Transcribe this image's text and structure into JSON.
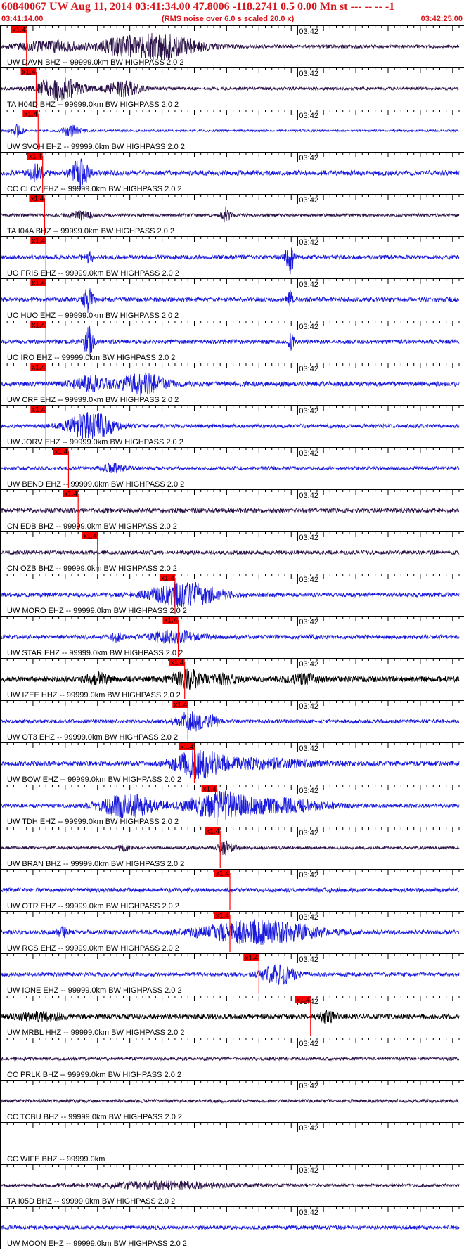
{
  "header": {
    "title": "60840067 UW Aug 11, 2014 03:41:34.00   47.8006 -118.2741  0.5 0.00 Mn st --- -- --  -1",
    "start_time": "03:41:14.00",
    "rms_note": "(RMS noise over 6.0 s scaled 20.0 x)",
    "end_time": "03:42:25.00"
  },
  "colors": {
    "header_text": "#d8141c",
    "pick_line": "#ff0000",
    "pick_flag": "#ff0000",
    "trace_blue": "#1a1adc",
    "trace_dark": "#2b1248",
    "trace_black": "#000000",
    "axis": "#000000"
  },
  "chart_data": {
    "type": "seismogram",
    "time_range": [
      "03:41:14.00",
      "03:42:25.00"
    ],
    "minute_tick_label": "03:42",
    "pick_flag_label": "x1.4",
    "traces": [
      {
        "label": "UW DAVN BHZ -- 99999.0km BW  HIGHPASS  2.0  2",
        "color": "dark",
        "pick_time": "03:41:18.0",
        "bursts": [
          {
            "t": 24.5,
            "w": 7,
            "a": 3.0
          },
          {
            "t": 8,
            "w": 6,
            "a": 1.2
          },
          {
            "t": 18,
            "w": 3,
            "a": 1.0
          }
        ],
        "base": 0.4
      },
      {
        "label": "TA H04D BHZ -- 99999.0km BW  HIGHPASS  2.0  2",
        "color": "dark",
        "pick_time": "03:41:19.5",
        "bursts": [
          {
            "t": 9,
            "w": 4,
            "a": 2.6
          },
          {
            "t": 19,
            "w": 3,
            "a": 1.7
          }
        ],
        "base": 0.35
      },
      {
        "label": "UW SVOH EHZ -- 99999.0km BW  HIGHPASS  2.0  2",
        "color": "blue",
        "pick_time": "03:41:19.8",
        "bursts": [
          {
            "t": 2.5,
            "w": 1,
            "a": 1.6
          },
          {
            "t": 11,
            "w": 1.5,
            "a": 1.5
          }
        ],
        "base": 0.25
      },
      {
        "label": "CC CLCV EHZ -- 99999.0km BW  HIGHPASS  2.0  2",
        "color": "blue",
        "pick_time": "03:41:20.5",
        "bursts": [
          {
            "t": 5.5,
            "w": 1.2,
            "a": 2.0
          },
          {
            "t": 12.3,
            "w": 1.5,
            "a": 3.4
          }
        ],
        "base": 0.6
      },
      {
        "label": "TA I04A BHZ -- 99999.0km BW  HIGHPASS  2.0  2",
        "color": "dark",
        "pick_time": "03:41:20.8",
        "bursts": [
          {
            "t": 34.9,
            "w": 0.8,
            "a": 1.6
          },
          {
            "t": 12.5,
            "w": 2,
            "a": 0.9
          }
        ],
        "base": 0.35
      },
      {
        "label": "UO FRIS EHZ -- 99999.0km BW  HIGHPASS  2.0  2",
        "color": "blue",
        "pick_time": "03:41:21.0",
        "bursts": [
          {
            "t": 44.8,
            "w": 0.7,
            "a": 4.2
          },
          {
            "t": 13.5,
            "w": 1,
            "a": 1.2
          }
        ],
        "base": 0.5
      },
      {
        "label": "UO HUO EHZ -- 99999.0km BW  HIGHPASS  2.0  2",
        "color": "blue",
        "pick_time": "03:41:21.0",
        "bursts": [
          {
            "t": 13.6,
            "w": 1,
            "a": 2.8
          },
          {
            "t": 44.8,
            "w": 0.6,
            "a": 1.7
          }
        ],
        "base": 0.5
      },
      {
        "label": "UO IRO EHZ -- 99999.0km BW  HIGHPASS  2.0  2",
        "color": "blue",
        "pick_time": "03:41:21.0",
        "bursts": [
          {
            "t": 13.6,
            "w": 0.8,
            "a": 3.5
          },
          {
            "t": 44.9,
            "w": 0.6,
            "a": 1.8
          }
        ],
        "base": 0.5
      },
      {
        "label": "UW CRF EHZ -- 99999.0km BW  HIGHPASS  2.0  2",
        "color": "blue",
        "pick_time": "03:41:21.0",
        "bursts": [
          {
            "t": 22,
            "w": 4,
            "a": 2.4
          },
          {
            "t": 13.8,
            "w": 3,
            "a": 1.6
          }
        ],
        "base": 0.55
      },
      {
        "label": "UW JORV EHZ -- 99999.0km BW  HIGHPASS  2.0  2",
        "color": "blue",
        "pick_time": "03:41:21.0",
        "bursts": [
          {
            "t": 14,
            "w": 4,
            "a": 3.2
          }
        ],
        "base": 0.45
      },
      {
        "label": "UW BEND EHZ -- 99999.0km BW  HIGHPASS  2.0  2",
        "color": "blue",
        "pick_time": "03:41:24.5",
        "bursts": [
          {
            "t": 17.5,
            "w": 2,
            "a": 0.9
          }
        ],
        "base": 0.4
      },
      {
        "label": "CN EDB BHZ -- 99999.0km BW  HIGHPASS  2.0  2",
        "color": "dark",
        "pick_time": "03:41:26.0",
        "bursts": [],
        "base": 0.55
      },
      {
        "label": "CN OZB BHZ -- 99999.0km BW  HIGHPASS  2.0  2",
        "color": "dark",
        "pick_time": "03:41:29.0",
        "bursts": [],
        "base": 0.45
      },
      {
        "label": "UW MORO EHZ -- 99999.0km BW  HIGHPASS  2.0  2",
        "color": "blue",
        "pick_time": "03:41:41.0",
        "bursts": [
          {
            "t": 28.5,
            "w": 6,
            "a": 2.8
          }
        ],
        "base": 0.5
      },
      {
        "label": "UW STAR EHZ -- 99999.0km BW  HIGHPASS  2.0  2",
        "color": "blue",
        "pick_time": "03:41:41.5",
        "bursts": [
          {
            "t": 27,
            "w": 4,
            "a": 1.4
          },
          {
            "t": 18,
            "w": 1,
            "a": 1.0
          }
        ],
        "base": 0.5
      },
      {
        "label": "UW IZEE HHZ -- 99999.0km BW  HIGHPASS  2.0  2",
        "color": "black",
        "pick_time": "03:41:42.5",
        "bursts": [
          {
            "t": 29,
            "w": 3,
            "a": 2.0
          },
          {
            "t": 15,
            "w": 2,
            "a": 1.2
          },
          {
            "t": 35,
            "w": 2,
            "a": 1.0
          },
          {
            "t": 47,
            "w": 3,
            "a": 0.9
          }
        ],
        "base": 0.65
      },
      {
        "label": "UW OT3 EHZ -- 99999.0km BW  HIGHPASS  2.0  2",
        "color": "blue",
        "pick_time": "03:41:43.0",
        "bursts": [
          {
            "t": 29.5,
            "w": 2.5,
            "a": 2.2
          },
          {
            "t": 33,
            "w": 1,
            "a": 1.0
          }
        ],
        "base": 0.45
      },
      {
        "label": "UW BOW EHZ -- 99999.0km BW  HIGHPASS  2.0  2",
        "color": "blue",
        "pick_time": "03:41:44.0",
        "bursts": [
          {
            "t": 30.5,
            "w": 4,
            "a": 3.0
          },
          {
            "t": 40,
            "w": 10,
            "a": 1.0
          }
        ],
        "base": 0.55
      },
      {
        "label": "UW TDH EHZ -- 99999.0km BW  HIGHPASS  2.0  2",
        "color": "blue",
        "pick_time": "03:41:47.5",
        "bursts": [
          {
            "t": 19.5,
            "w": 5,
            "a": 2.6
          },
          {
            "t": 34,
            "w": 6,
            "a": 3.0
          },
          {
            "t": 44,
            "w": 8,
            "a": 1.4
          }
        ],
        "base": 0.45
      },
      {
        "label": "UW BRAN BHZ -- 99999.0km BW  HIGHPASS  2.0  2",
        "color": "dark",
        "pick_time": "03:41:48.0",
        "bursts": [
          {
            "t": 35,
            "w": 1.5,
            "a": 1.6
          },
          {
            "t": 19,
            "w": 1,
            "a": 0.7
          }
        ],
        "base": 0.35
      },
      {
        "label": "UW OTR EHZ -- 99999.0km BW  HIGHPASS  2.0  2",
        "color": "blue",
        "pick_time": "03:41:49.5",
        "bursts": [],
        "base": 0.5
      },
      {
        "label": "UW RCS EHZ -- 99999.0km BW  HIGHPASS  2.0  2",
        "color": "blue",
        "pick_time": "03:41:49.5",
        "bursts": [
          {
            "t": 40,
            "w": 10,
            "a": 2.6
          },
          {
            "t": 9.5,
            "w": 1,
            "a": 1.0
          }
        ],
        "base": 0.5
      },
      {
        "label": "UW IONE EHZ -- 99999.0km BW  HIGHPASS  2.0  2",
        "color": "blue",
        "pick_time": "03:41:54.0",
        "bursts": [
          {
            "t": 43,
            "w": 3,
            "a": 2.2
          }
        ],
        "base": 0.45
      },
      {
        "label": "UW MRBL HHZ -- 99999.0km BW  HIGHPASS  2.0  2",
        "color": "black",
        "pick_time": "03:42:02.0",
        "bursts": [
          {
            "t": 50.5,
            "w": 1.5,
            "a": 1.3
          },
          {
            "t": 6,
            "w": 4,
            "a": 0.8
          }
        ],
        "base": 0.6
      },
      {
        "label": "CC PRLK BHZ -- 99999.0km BW  HIGHPASS  2.0  2",
        "color": "dark",
        "pick_time": null,
        "bursts": [],
        "base": 0.4
      },
      {
        "label": "CC TCBU BHZ -- 99999.0km BW  HIGHPASS  2.0  2",
        "color": "dark",
        "pick_time": null,
        "bursts": [],
        "base": 0.4
      },
      {
        "label": "CC WIFE BHZ -- 99999.0km",
        "color": "none",
        "pick_time": null,
        "bursts": [],
        "base": 0
      },
      {
        "label": "TA I05D BHZ -- 99999.0km BW  HIGHPASS  2.0  2",
        "color": "dark",
        "pick_time": null,
        "bursts": [
          {
            "t": 25,
            "w": 12,
            "a": 0.8
          }
        ],
        "base": 0.35
      },
      {
        "label": "UW MOON EHZ -- 99999.0km BW  HIGHPASS  2.0  2",
        "color": "blue",
        "pick_time": null,
        "bursts": [],
        "base": 0.45
      }
    ]
  }
}
